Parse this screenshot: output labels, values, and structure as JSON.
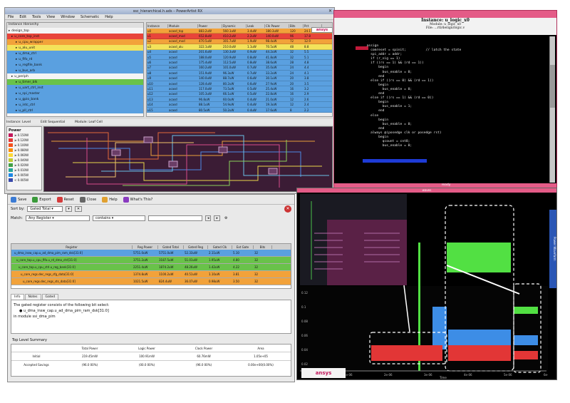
{
  "colors": {
    "orange_row": "#f2a23a",
    "red_row": "#e8443a",
    "yellow_row": "#f3e25a",
    "blue_row": "#5aa0e0",
    "green_row": "#69c24a",
    "terminal_bg": "#000000",
    "accent_pink": "#e0306a",
    "power_green": "#52e043",
    "power_blue": "#3d8de6",
    "power_red": "#e23636"
  },
  "powerartist_window": {
    "title": "ssc_hierarchical.h.ads – PowerArtist RX",
    "menu": [
      "File",
      "Edit",
      "Tools",
      "View",
      "Window",
      "Schematic",
      "Help"
    ],
    "tree_header": "Instance Hierarchy",
    "tree_items": [
      {
        "label": "design_top",
        "color": "none"
      },
      {
        "label": "u_core_top_inst",
        "color": "red"
      },
      {
        "label": "u_cpu_wrapper",
        "color": "orange"
      },
      {
        "label": "u_alu_unit",
        "color": "yellow"
      },
      {
        "label": "u_dma_ctrl",
        "color": "blue"
      },
      {
        "label": "u_fifo_rd",
        "color": "blue"
      },
      {
        "label": "u_regfile_bank",
        "color": "blue"
      },
      {
        "label": "u_bus_arb",
        "color": "blue"
      },
      {
        "label": "u_periph",
        "color": "none"
      },
      {
        "label": "u_timer_blk",
        "color": "green"
      },
      {
        "label": "u_uart_ctrl_inst",
        "color": "blue"
      },
      {
        "label": "u_spi_master",
        "color": "blue"
      },
      {
        "label": "u_gpio_bank",
        "color": "blue"
      },
      {
        "label": "u_intc_ctrl",
        "color": "blue"
      },
      {
        "label": "u_pll_ctrl",
        "color": "blue"
      }
    ],
    "table_headers": [
      "Instance",
      "Module",
      "Power",
      "Dynamic",
      "Leak",
      "Clk Power",
      "Bits",
      "Pct"
    ],
    "table_rows": [
      {
        "color": "orange",
        "cells": [
          "u0",
          "acasd_top",
          "883.2uW",
          "560.1uW",
          "3.4uW",
          "180.3uW",
          "120",
          "24.1"
        ]
      },
      {
        "color": "red",
        "cells": [
          "u1",
          "acasd_mod",
          "652.8uW",
          "410.2uW",
          "2.2uW",
          "140.0uW",
          "96",
          "17.8"
        ]
      },
      {
        "color": "orange",
        "cells": [
          "u2",
          "acasd_mod",
          "470.5uW",
          "301.7uW",
          "1.9uW",
          "98.4uW",
          "72",
          "12.9"
        ]
      },
      {
        "color": "yellow",
        "cells": [
          "u3",
          "acasd_alu",
          "322.1uW",
          "210.0uW",
          "1.1uW",
          "70.5uW",
          "48",
          "8.8"
        ]
      },
      {
        "color": "blue",
        "cells": [
          "u4",
          "acasd",
          "201.6uW",
          "130.3uW",
          "0.9uW",
          "44.2uW",
          "32",
          "5.5"
        ]
      },
      {
        "color": "blue",
        "cells": [
          "u5",
          "acasd",
          "188.0uW",
          "120.9uW",
          "0.8uW",
          "41.8uW",
          "32",
          "5.1"
        ]
      },
      {
        "color": "blue",
        "cells": [
          "u6",
          "acasd",
          "175.4uW",
          "112.5uW",
          "0.8uW",
          "38.6uW",
          "28",
          "4.8"
        ]
      },
      {
        "color": "blue",
        "cells": [
          "u7",
          "acasd",
          "160.2uW",
          "101.0uW",
          "0.7uW",
          "35.0uW",
          "24",
          "4.4"
        ]
      },
      {
        "color": "blue",
        "cells": [
          "u8",
          "acasd",
          "151.9uW",
          "96.3uW",
          "0.7uW",
          "33.2uW",
          "24",
          "4.1"
        ]
      },
      {
        "color": "blue",
        "cells": [
          "u9",
          "acasd",
          "140.0uW",
          "88.7uW",
          "0.6uW",
          "30.1uW",
          "20",
          "3.8"
        ]
      },
      {
        "color": "blue",
        "cells": [
          "u10",
          "acasd",
          "128.4uW",
          "80.2uW",
          "0.6uW",
          "27.9uW",
          "20",
          "3.5"
        ]
      },
      {
        "color": "blue",
        "cells": [
          "u11",
          "acasd",
          "117.0uW",
          "73.5uW",
          "0.5uW",
          "25.4uW",
          "16",
          "3.2"
        ]
      },
      {
        "color": "blue",
        "cells": [
          "u12",
          "acasd",
          "105.3uW",
          "66.1uW",
          "0.5uW",
          "22.8uW",
          "16",
          "2.9"
        ]
      },
      {
        "color": "blue",
        "cells": [
          "u13",
          "acasd",
          "96.8uW",
          "60.0uW",
          "0.4uW",
          "21.0uW",
          "12",
          "2.6"
        ]
      },
      {
        "color": "blue",
        "cells": [
          "u14",
          "acasd",
          "88.1uW",
          "54.9uW",
          "0.4uW",
          "19.3uW",
          "12",
          "2.4"
        ]
      },
      {
        "color": "blue",
        "cells": [
          "u15",
          "acasd",
          "80.5uW",
          "50.2uW",
          "0.4uW",
          "17.6uW",
          "8",
          "2.2"
        ]
      }
    ],
    "schematic_toolbar": [
      "Instance: Level",
      "Edit Sequential",
      "Module: Leaf Cell"
    ],
    "legend_title": "Power",
    "legend_values": [
      "≥ 0.150W",
      "≥ 0.120W",
      "≥ 0.100W",
      "≥ 0.080W",
      "≥ 0.060W",
      "≥ 0.040W",
      "≥ 0.020W",
      "≥ 0.010W",
      "≥ 0.005W",
      "< 0.005W"
    ],
    "logo": "ansys"
  },
  "code_window": {
    "title": "Instance: u_logic_x0",
    "subtitle": "Module: u_logic_x0",
    "file": "File: ...rtl/design/logic.v",
    "lines": [
      "  assign",
      "    comreset = spinit;          // latch the state",
      "    spi_addr = addr;",
      "    if (r_sig == 1)",
      "    if ((rs == 1) && (rd == 1))",
      "        begin",
      "          bus_enable = 0;",
      "        end",
      "    else if ((rs == 0) && (rd == 1))",
      "        begin",
      "          bus_enable = 0;",
      "        end",
      "    else if ((rs == 1) && (rd == 0))",
      "        begin",
      "          bus_enable = 1;",
      "        end",
      "    else",
      "        begin",
      "          bus_enable = 0;",
      "        end",
      "    always @(posedge clk or posedge rst)",
      "        begin",
      "          qcount = cnt8;",
      "          bus_enable = 0;"
    ],
    "status": "ready"
  },
  "reg_panel": {
    "toolbar": [
      "Save",
      "Export",
      "Reset",
      "Close",
      "Help",
      "What's This?"
    ],
    "sort_label": "Sort by:",
    "sort_value": "Gated Total",
    "match_label": "Match:",
    "match_value": "Any Register",
    "contains_value": "contains",
    "table_headers": [
      "Register",
      "Reg Power",
      "Gated Total",
      "Gated Reg",
      "Gated Clk",
      "Ext Gate",
      "Bits"
    ],
    "table_rows": [
      {
        "color": "blue",
        "cells": [
          "u_dma_insw_cap.u_ad_dma_pim_ram_dsk[31:0]",
          "5751.0uW",
          "5751.0uW",
          "52.33uW",
          "2.11uW",
          "5.10",
          "32"
        ]
      },
      {
        "color": "green",
        "cells": [
          "u_core_top.u_cpu_fifo.u_rd_dma_ctrl[31:0]",
          "3751.2uW",
          "3187.5uW",
          "51.01uW",
          "1.95uW",
          "4.80",
          "32"
        ]
      },
      {
        "color": "green",
        "cells": [
          "u_core_top.u_cpu_ctrl.u_reg_bank[31:0]",
          "2251.4uW",
          "1874.2uW",
          "48.26uW",
          "1.42uW",
          "4.22",
          "32"
        ]
      },
      {
        "color": "orange",
        "cells": [
          "u_core_regs.dec_regs_cfg_data[31:0]",
          "1374.8uW",
          "1100.2uW",
          "40.51uW",
          "1.10uW",
          "3.81",
          "32"
        ]
      },
      {
        "color": "orange",
        "cells": [
          "u_core_regs.dec_regs_sts_data[31:0]",
          "1021.5uW",
          "824.4uW",
          "36.07uW",
          "0.98uW",
          "3.50",
          "32"
        ]
      }
    ],
    "detail_tabs": [
      "Info",
      "Notes",
      "Gated"
    ],
    "detail_text": "The gated register consists of the following bit select:",
    "detail_bullet": "u_dma_insw_cap.u_ad_dma_pim_ram_dsk[31:0]",
    "detail_module": "in module ssi_dma_pim",
    "summary_title": "Top Level Summary",
    "summary_headers": [
      "",
      "Total Power",
      "Logic Power",
      "Clock Power",
      "Area"
    ],
    "summary_rows": [
      [
        "Initial",
        "219.45mW",
        "100.91mW",
        "60.76mW",
        "1.05e+05"
      ],
      [
        "Accepted Savings",
        "(96.0 00%)",
        "(00.0 00%)",
        "(96.0 00%)",
        "0.00e+00(0.00%)"
      ]
    ]
  },
  "wave_window": {
    "title": "waves",
    "side_tab": "Power Waveform",
    "x_ticks": [
      "0",
      "1e-06",
      "2e-06",
      "3e-06",
      "4e-06",
      "5e-06",
      "6e-06"
    ],
    "x_label": "Time",
    "y_ticks": [
      "0.12",
      "0.1",
      "0.08",
      "0.06",
      "0.04",
      "0.02"
    ],
    "logo": "ansys"
  }
}
